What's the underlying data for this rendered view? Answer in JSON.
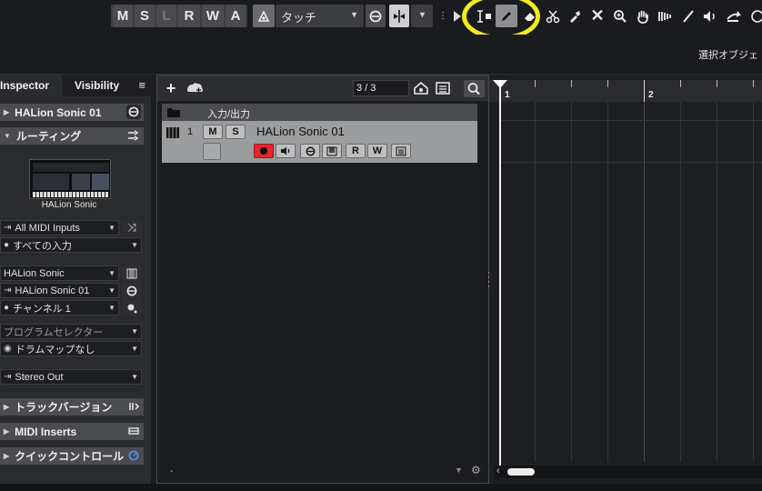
{
  "toolbar": {
    "automation_buttons": [
      "M",
      "S",
      "L",
      "R",
      "W",
      "A"
    ],
    "automation_mode": "タッチ",
    "tools": [
      {
        "name": "range-tool",
        "active": false
      },
      {
        "name": "draw-tool",
        "active": true
      },
      {
        "name": "erase-tool",
        "active": false
      },
      {
        "name": "split-tool",
        "active": false
      },
      {
        "name": "glue-tool",
        "active": false
      },
      {
        "name": "mute-tool",
        "active": false
      },
      {
        "name": "zoom-tool",
        "active": false
      },
      {
        "name": "hand-tool",
        "active": false
      },
      {
        "name": "comp-tool",
        "active": false
      },
      {
        "name": "line-tool",
        "active": false
      },
      {
        "name": "play-tool",
        "active": false
      },
      {
        "name": "timewarp-tool",
        "active": false
      }
    ],
    "highlight_color": "#f4ec19"
  },
  "secondary_bar": {
    "text": "選択オブジェ"
  },
  "inspector": {
    "tabs": [
      "Inspector",
      "Visibility"
    ],
    "menu_icon": "≡",
    "track_name": "HALion Sonic 01",
    "routing_title": "ルーティング",
    "instrument_caption": "HALion Sonic",
    "midi_input": "All MIDI Inputs",
    "midi_channel_in": "すべての入力",
    "instrument": "HALion Sonic",
    "output_instrument": "HALion Sonic 01",
    "channel": "チャンネル 1",
    "program_selector": "プログラムセレクター",
    "drum_map": "ドラムマップなし",
    "audio_out": "Stereo Out",
    "sections": [
      "トラックバージョン",
      "MIDI Inserts",
      "クイックコントロール"
    ]
  },
  "tracklist": {
    "counter": "3 / 3",
    "folder_label": "入力/出力",
    "track_number": "1",
    "track_name": "HALion Sonic 01",
    "ms_buttons": [
      "M",
      "S"
    ],
    "rw_buttons": [
      "R",
      "W"
    ],
    "footer_dash": "-"
  },
  "ruler": {
    "markers": [
      "1",
      "2"
    ]
  },
  "colors": {
    "record_red": "#e3262f",
    "track_selected": "#9b9c9e",
    "quick_control_blue": "#4a90e2"
  }
}
